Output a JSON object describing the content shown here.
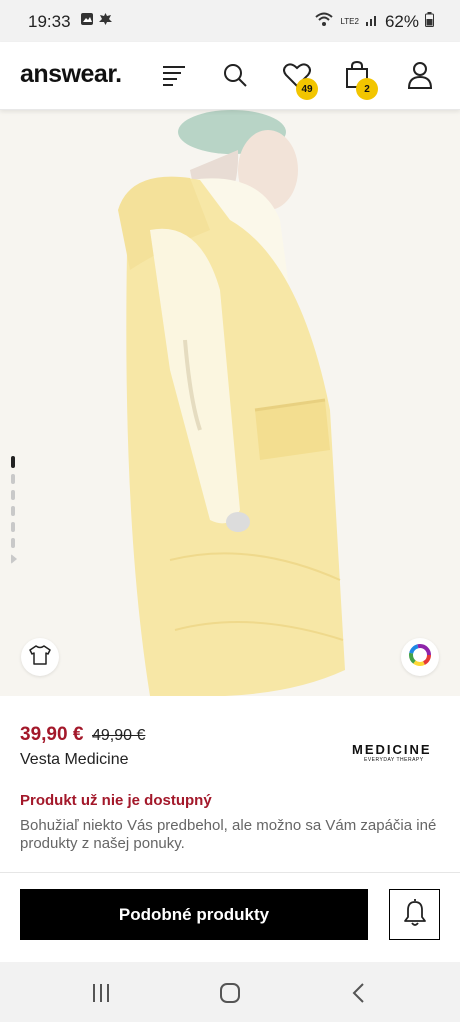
{
  "status_bar": {
    "time": "19:33",
    "battery": "62%",
    "network": "LTE2"
  },
  "header": {
    "logo": "answear.",
    "icons": {
      "menu": "menu-icon",
      "search": "search-icon",
      "wishlist": "heart-icon",
      "cart": "bag-icon",
      "account": "user-icon"
    },
    "wishlist_count": "49",
    "cart_count": "2"
  },
  "gallery": {
    "image_count": 7,
    "current_index": 1
  },
  "product": {
    "price": "39,90 €",
    "old_price": "49,90 €",
    "name": "Vesta Medicine",
    "brand": "MEDICINE",
    "brand_tagline": "EVERYDAY THERAPY",
    "unavailable_title": "Produkt už nie je dostupný",
    "unavailable_text": "Bohužiaľ niekto Vás predbehol, ale možno sa Vám zapáčia iné produkty z našej ponuky."
  },
  "actions": {
    "similar_button": "Podobné produkty"
  },
  "colors": {
    "price_red": "#a3182a",
    "badge_yellow": "#f2c500",
    "garment_yellow": "#f7e7a6"
  }
}
